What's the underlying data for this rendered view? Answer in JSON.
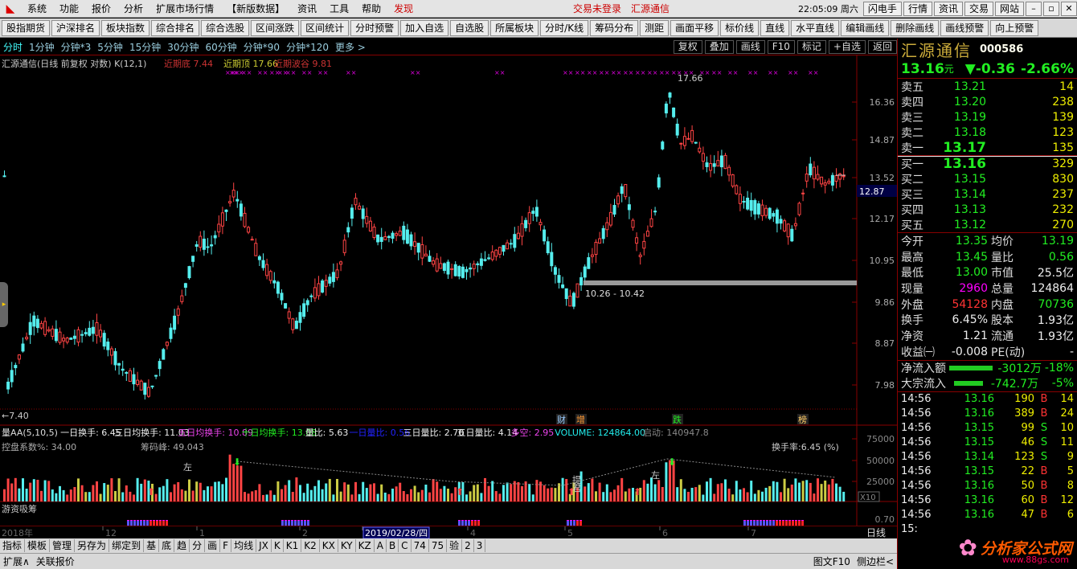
{
  "menubar": {
    "items": [
      "系统",
      "功能",
      "报价",
      "分析",
      "扩展市场行情",
      "【新版数据】",
      "资讯",
      "工具",
      "帮助",
      "发现"
    ],
    "login": "交易未登录",
    "broker": "汇源通信",
    "clock": "22:05:09 周六",
    "right_buttons": [
      "闪电手",
      "行情",
      "资讯",
      "交易",
      "网站"
    ]
  },
  "toolbar": [
    "股指期货",
    "沪深排名",
    "板块指数",
    "综合排名",
    "综合选股",
    "区间涨跌",
    "区间统计",
    "分时预警",
    "加入自选",
    "自选股",
    "所属板块",
    "分时/K线",
    "筹码分布",
    "测距",
    "画面平移",
    "标价线",
    "直线",
    "水平直线",
    "编辑画线",
    "删除画线",
    "画线预警",
    "向上预警"
  ],
  "periods": [
    "分时",
    "1分钟",
    "分钟*3",
    "5分钟",
    "15分钟",
    "30分钟",
    "60分钟",
    "分钟*90",
    "分钟*120",
    "更多 >"
  ],
  "period_right": [
    "复权",
    "叠加",
    "画线",
    "F10",
    "标记",
    "+自选",
    "返回"
  ],
  "chart": {
    "title": "汇源通信(日线 前复权 对数) K(12,1)",
    "legend1": "近期底 7.44",
    "legend2": "近期顶 17.66",
    "legend3": "近期波谷 9.81",
    "y_ticks": [
      "16.36",
      "14.87",
      "13.52",
      "12.17",
      "10.95",
      "9.86",
      "8.87",
      "7.98"
    ],
    "current_price": "12.87",
    "high_label": "17.66",
    "low_label": "←7.40",
    "range_label": "10.26 - 10.42",
    "events": [
      "财",
      "增",
      "跌",
      "榜"
    ]
  },
  "volume": {
    "header": [
      {
        "t": "量AA(5,10,5)",
        "c": "#ddd"
      },
      {
        "t": "一日换手: 6.45",
        "c": "#eee"
      },
      {
        "t": "三日均换手: 11.03",
        "c": "#eee"
      },
      {
        "t": "五日均换手: 10.89",
        "c": "#e4e"
      },
      {
        "t": "十日均换手: 13.08",
        "c": "#2e2"
      },
      {
        "t": "量比: 5.63",
        "c": "#eee"
      },
      {
        "t": "一日量比: 0.56",
        "c": "#22f"
      },
      {
        "t": "三日量比: 2.70",
        "c": "#eee"
      },
      {
        "t": "五日量比: 4.14",
        "c": "#eee"
      },
      {
        "t": "多空: 2.95",
        "c": "#e4e"
      },
      {
        "t": "VOLUME: 124864.00",
        "c": "#2ee"
      },
      {
        "t": "启动: 140947.8",
        "c": "#888"
      }
    ],
    "sub1": "控盘系数%: 34.00",
    "sub2": "筹码峰: 49.043",
    "turnover": "换手率:6.45 (%)",
    "y_ticks": [
      "75000",
      "50000",
      "25000"
    ],
    "unit": "X10",
    "marks": [
      "左",
      "左",
      "提",
      "君"
    ]
  },
  "indicator": {
    "title": "游资吸筹",
    "y_tick": "0.70"
  },
  "timeaxis": {
    "labels": [
      "2018年",
      "12",
      "1",
      "2",
      "2019/02/28/四",
      "4",
      "5",
      "6",
      "7"
    ],
    "right": "日线"
  },
  "bottom_tabs": [
    "指标",
    "模板",
    "管理",
    "另存为",
    "绑定到",
    "基",
    "底",
    "趋",
    "分",
    "画",
    "F",
    "均线",
    "JX",
    "K",
    "K1",
    "K2",
    "KX",
    "KY",
    "KZ",
    "A",
    "B",
    "C",
    "74",
    "75",
    "验",
    "2",
    "3"
  ],
  "bottom_status": {
    "left1": "扩展∧",
    "left2": "关联报价",
    "right1": "图文F10",
    "right2": "侧边栏<"
  },
  "quote": {
    "name": "汇源通信",
    "code": "000586",
    "price": "13.16",
    "unit": "元",
    "change": "▼-0.36",
    "pct": "-2.66%",
    "asks": [
      {
        "l": "卖五",
        "p": "13.21",
        "v": "14"
      },
      {
        "l": "卖四",
        "p": "13.20",
        "v": "238"
      },
      {
        "l": "卖三",
        "p": "13.19",
        "v": "139"
      },
      {
        "l": "卖二",
        "p": "13.18",
        "v": "123"
      },
      {
        "l": "卖一",
        "p": "13.17",
        "v": "135"
      }
    ],
    "bids": [
      {
        "l": "买一",
        "p": "13.16",
        "v": "329"
      },
      {
        "l": "买二",
        "p": "13.15",
        "v": "830"
      },
      {
        "l": "买三",
        "p": "13.14",
        "v": "237"
      },
      {
        "l": "买四",
        "p": "13.13",
        "v": "232"
      },
      {
        "l": "买五",
        "p": "13.12",
        "v": "270"
      }
    ],
    "stats": [
      {
        "l1": "今开",
        "v1": "13.35",
        "c1": "g",
        "l2": "均价",
        "v2": "13.19",
        "c2": "g"
      },
      {
        "l1": "最高",
        "v1": "13.45",
        "c1": "g",
        "l2": "量比",
        "v2": "0.56",
        "c2": "g"
      },
      {
        "l1": "最低",
        "v1": "13.00",
        "c1": "g",
        "l2": "市值",
        "v2": "25.5亿",
        "c2": "w"
      },
      {
        "l1": "现量",
        "v1": "2960",
        "c1": "m",
        "l2": "总量",
        "v2": "124864",
        "c2": "w"
      },
      {
        "l1": "外盘",
        "v1": "54128",
        "c1": "r",
        "l2": "内盘",
        "v2": "70736",
        "c2": "g"
      },
      {
        "l1": "换手",
        "v1": "6.45%",
        "c1": "w",
        "l2": "股本",
        "v2": "1.93亿",
        "c2": "w"
      },
      {
        "l1": "净资",
        "v1": "1.21",
        "c1": "w",
        "l2": "流通",
        "v2": "1.93亿",
        "c2": "w"
      },
      {
        "l1": "收益㈠",
        "v1": "-0.008",
        "c1": "w",
        "l2": "PE(动)",
        "v2": "-",
        "c2": "w"
      }
    ],
    "flows": [
      {
        "l": "净流入额",
        "v": "-3012万",
        "pc": "-18%"
      },
      {
        "l": "大宗流入",
        "v": "-742.7万",
        "pc": "-5%"
      }
    ],
    "ticks": [
      {
        "t": "14:56",
        "p": "13.16",
        "v": "190",
        "s": "B",
        "n": "14"
      },
      {
        "t": "14:56",
        "p": "13.16",
        "v": "389",
        "s": "B",
        "n": "24"
      },
      {
        "t": "14:56",
        "p": "13.15",
        "v": "99",
        "s": "S",
        "n": "10"
      },
      {
        "t": "14:56",
        "p": "13.15",
        "v": "46",
        "s": "S",
        "n": "11"
      },
      {
        "t": "14:56",
        "p": "13.14",
        "v": "123",
        "s": "S",
        "n": "9"
      },
      {
        "t": "14:56",
        "p": "13.15",
        "v": "22",
        "s": "B",
        "n": "5"
      },
      {
        "t": "14:56",
        "p": "13.16",
        "v": "50",
        "s": "B",
        "n": "8"
      },
      {
        "t": "14:56",
        "p": "13.16",
        "v": "60",
        "s": "B",
        "n": "12"
      },
      {
        "t": "14:56",
        "p": "13.16",
        "v": "47",
        "s": "B",
        "n": "6"
      },
      {
        "t": "15:",
        "p": "",
        "v": "",
        "s": "",
        "n": ""
      }
    ]
  },
  "watermark": {
    "main": "分析家公式网",
    "sub": "www.88gs.com"
  }
}
